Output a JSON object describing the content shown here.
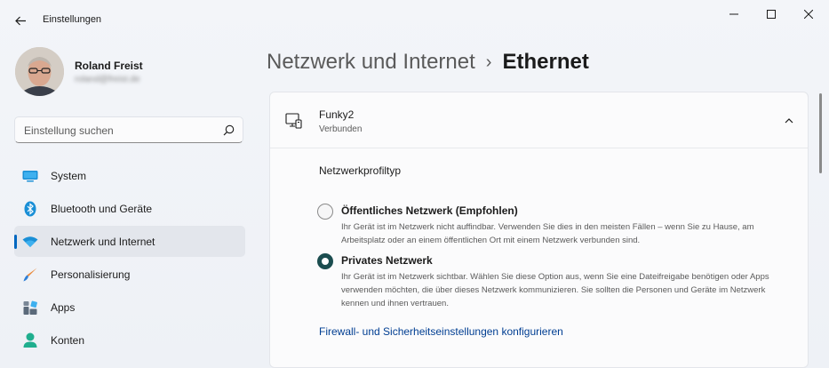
{
  "window": {
    "title": "Einstellungen",
    "controls": {
      "minimize": "minimize-icon",
      "maximize": "maximize-icon",
      "close": "close-icon"
    }
  },
  "user": {
    "name": "Roland Freist",
    "email": "roland@freist.de"
  },
  "search": {
    "placeholder": "Einstellung suchen"
  },
  "sidebar": {
    "items": [
      {
        "label": "System",
        "icon": "monitor-icon",
        "selected": false
      },
      {
        "label": "Bluetooth und Geräte",
        "icon": "bluetooth-icon",
        "selected": false
      },
      {
        "label": "Netzwerk und Internet",
        "icon": "wifi-icon",
        "selected": true
      },
      {
        "label": "Personalisierung",
        "icon": "brush-icon",
        "selected": false
      },
      {
        "label": "Apps",
        "icon": "apps-icon",
        "selected": false
      },
      {
        "label": "Konten",
        "icon": "person-icon",
        "selected": false
      }
    ]
  },
  "header": {
    "parent": "Netzwerk und Internet",
    "separator": "›",
    "current": "Ethernet"
  },
  "connection": {
    "name": "Funky2",
    "status": "Verbunden"
  },
  "profile": {
    "title": "Netzwerkprofiltyp",
    "options": [
      {
        "label": "Öffentliches Netzwerk (Empfohlen)",
        "description": "Ihr Gerät ist im Netzwerk nicht auffindbar. Verwenden Sie dies in den meisten Fällen – wenn Sie zu Hause, am Arbeitsplatz oder an einem öffentlichen Ort mit einem Netzwerk verbunden sind.",
        "selected": false
      },
      {
        "label": "Privates Netzwerk",
        "description": "Ihr Gerät ist im Netzwerk sichtbar. Wählen Sie diese Option aus, wenn Sie eine Dateifreigabe benötigen oder Apps verwenden möchten, die über dieses Netzwerk kommunizieren. Sie sollten die Personen und Geräte im Netzwerk kennen und ihnen vertrauen.",
        "selected": true
      }
    ]
  },
  "firewall_link": "Firewall- und Sicherheitseinstellungen konfigurieren",
  "colors": {
    "accent": "#0067c0",
    "radio_selected": "#1b4d4f",
    "link": "#003e92"
  }
}
